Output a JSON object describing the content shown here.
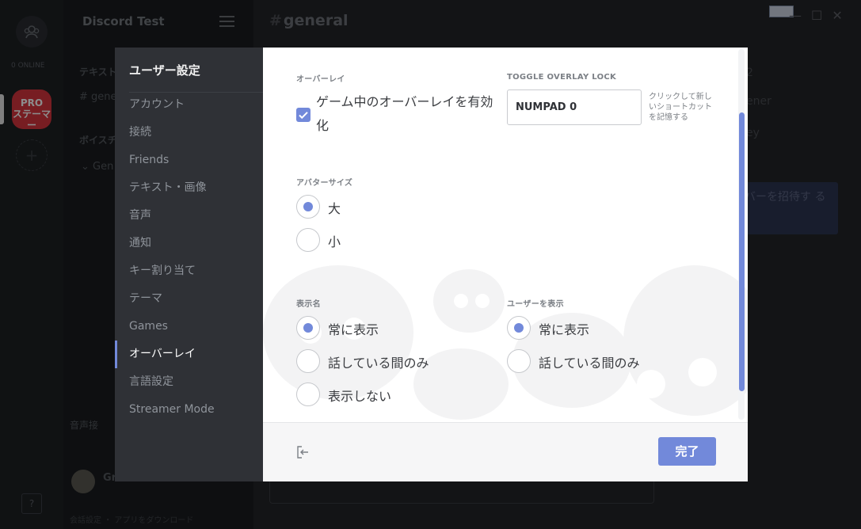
{
  "app": {
    "server_name": "Discord Test",
    "online_count": "0 ONLINE",
    "guild_label": "PRO\nステーマー",
    "channel_title": "general",
    "text_channels_label": "テキスト",
    "channel_general": "# gene",
    "voice_channels_label": "ボイスチ",
    "voice_general": "Gen",
    "voice_status": "音声接",
    "user_name": "Gr",
    "download_links": "会話設定 ・ アプリをダウンロード",
    "side_text_1": "2",
    "side_text_2": "ener",
    "side_text_3": "ey",
    "invite_label": "バーを招待す る",
    "help_label": "?"
  },
  "settings": {
    "title": "ユーザー設定",
    "nav": [
      {
        "label": "アカウント",
        "active": false
      },
      {
        "label": "接続",
        "active": false
      },
      {
        "label": "Friends",
        "active": false
      },
      {
        "label": "テキスト・画像",
        "active": false
      },
      {
        "label": "音声",
        "active": false
      },
      {
        "label": "通知",
        "active": false
      },
      {
        "label": "キー割り当て",
        "active": false
      },
      {
        "label": "テーマ",
        "active": false
      },
      {
        "label": "Games",
        "active": false
      },
      {
        "label": "オーバーレイ",
        "active": true
      },
      {
        "label": "言語設定",
        "active": false
      },
      {
        "label": "Streamer Mode",
        "active": false
      }
    ]
  },
  "overlay": {
    "section_label": "オーバーレイ",
    "enable_checkbox_label": "ゲーム中のオーバーレイを有効化",
    "enable_checked": true,
    "toggle_lock_label": "TOGGLE OVERLAY LOCK",
    "toggle_lock_value": "NUMPAD 0",
    "toggle_lock_hint": "クリックして新しいショートカットを記憶する",
    "avatar_size_label": "アバターサイズ",
    "avatar_options": [
      {
        "label": "大",
        "checked": true
      },
      {
        "label": "小",
        "checked": false
      }
    ],
    "display_name_label": "表示名",
    "display_name_options": [
      {
        "label": "常に表示",
        "checked": true
      },
      {
        "label": "話している間のみ",
        "checked": false
      },
      {
        "label": "表示しない",
        "checked": false
      }
    ],
    "show_users_label": "ユーザーを表示",
    "show_users_options": [
      {
        "label": "常に表示",
        "checked": true
      },
      {
        "label": "話している間のみ",
        "checked": false
      }
    ]
  },
  "footer": {
    "done_label": "完了",
    "exit_icon": "logout-icon"
  },
  "colors": {
    "accent": "#7289da",
    "nav_bg": "#2f3136",
    "content_bg": "#ffffff"
  }
}
